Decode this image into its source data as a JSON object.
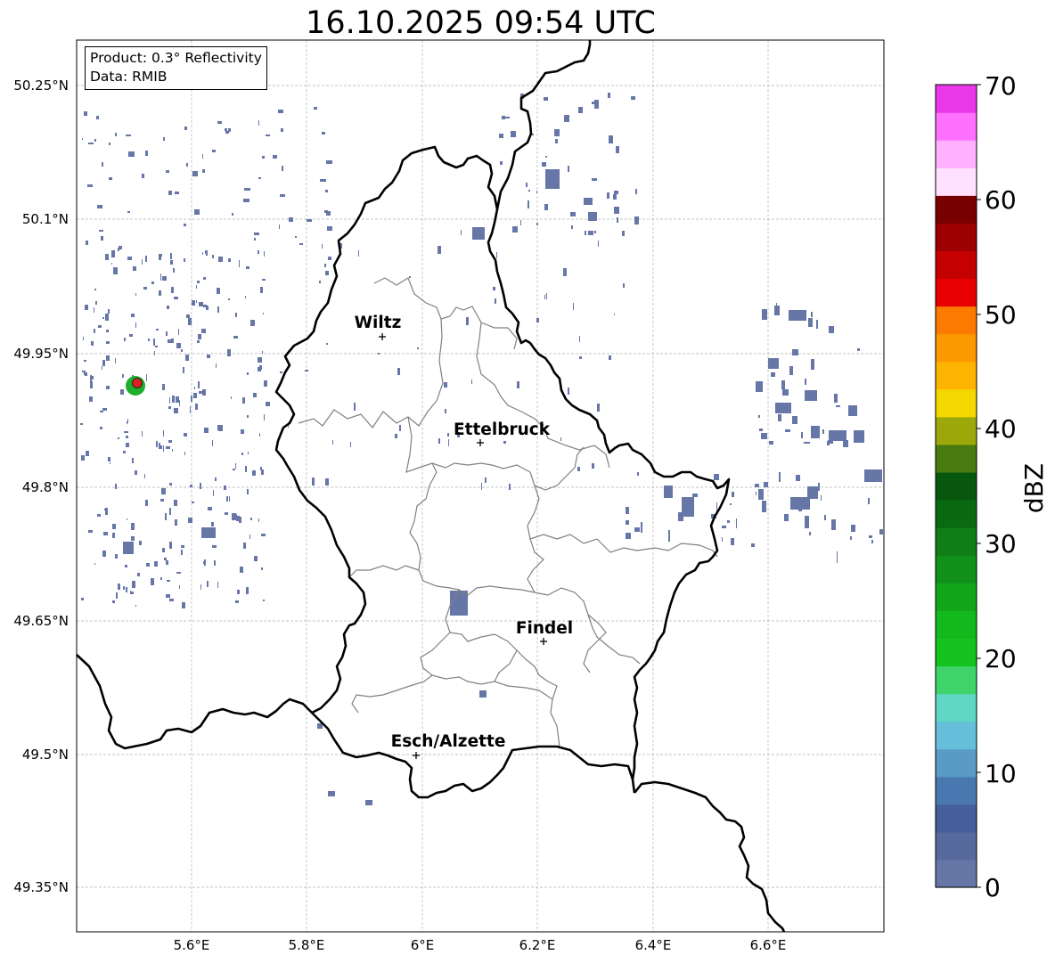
{
  "title": "16.10.2025 09:54 UTC",
  "info": {
    "product": "Product: 0.3° Reflectivity",
    "data": "Data: RMIB"
  },
  "lat_ticks": [
    "50.25°N",
    "50.1°N",
    "49.95°N",
    "49.8°N",
    "49.65°N",
    "49.5°N",
    "49.35°N"
  ],
  "lon_ticks": [
    "5.6°E",
    "5.8°E",
    "6°E",
    "6.2°E",
    "6.4°E",
    "6.6°E"
  ],
  "cities": [
    {
      "name": "Wiltz"
    },
    {
      "name": "Ettelbruck"
    },
    {
      "name": "Findel"
    },
    {
      "name": "Esch/Alzette"
    }
  ],
  "colorbar": {
    "label": "dBZ",
    "ticks": [
      "0",
      "10",
      "20",
      "30",
      "40",
      "50",
      "60",
      "70"
    ],
    "colors": [
      "#6676a6",
      "#566a9e",
      "#465e9c",
      "#4978b0",
      "#5a9bc6",
      "#65bfda",
      "#60d6c4",
      "#3fd46a",
      "#14c21e",
      "#12b81c",
      "#12a61a",
      "#11901a",
      "#0f7e16",
      "#0a6a12",
      "#07580e",
      "#487a10",
      "#9ca80a",
      "#f2d800",
      "#fcb400",
      "#fc9800",
      "#fc7a00",
      "#e80000",
      "#c40000",
      "#9c0000",
      "#780000",
      "#ffe0ff",
      "#ffb0ff",
      "#ff70ff",
      "#e838e8"
    ]
  },
  "echo_color": "#6676a6"
}
